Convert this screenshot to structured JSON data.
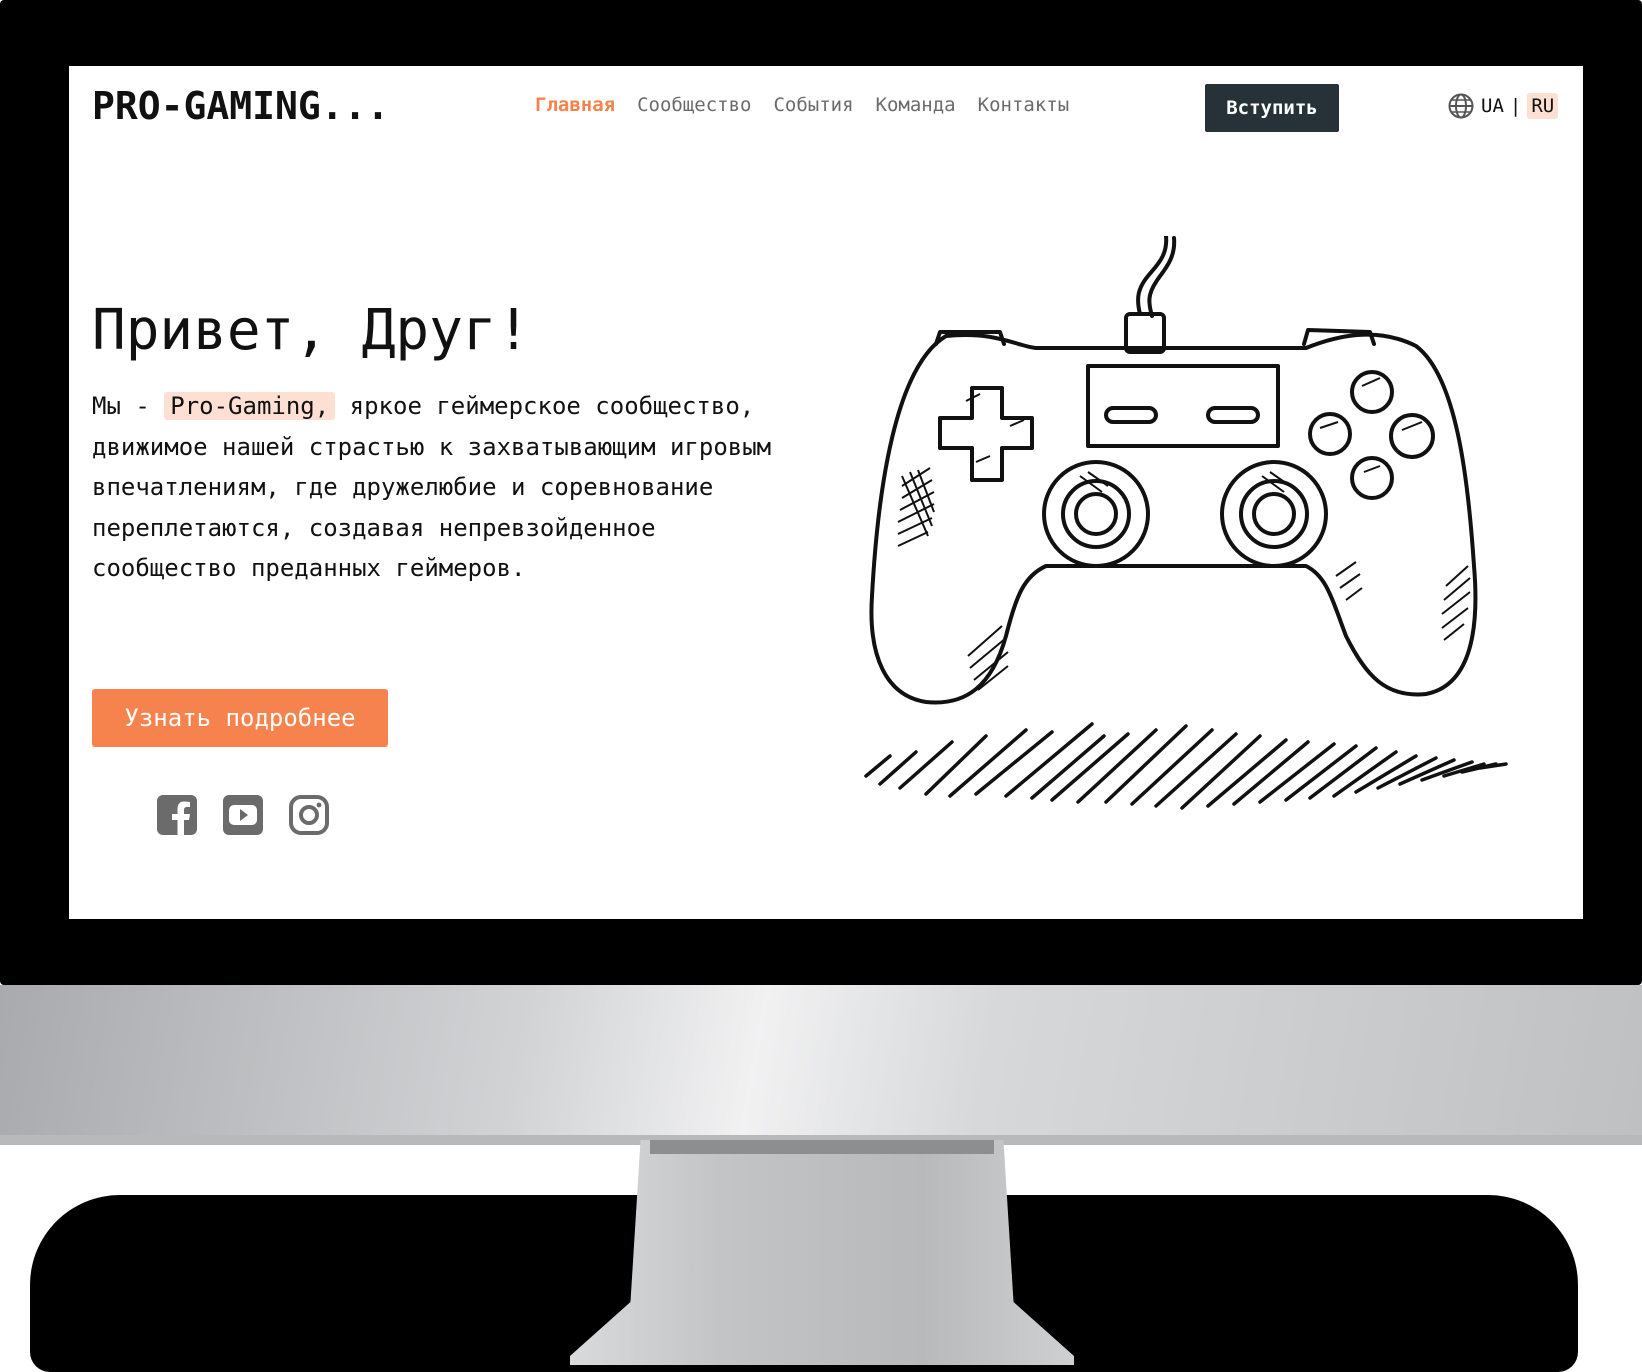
{
  "header": {
    "logo": "PRO-GAMING...",
    "nav": [
      {
        "label": "Главная",
        "active": true
      },
      {
        "label": "Сообщество",
        "active": false
      },
      {
        "label": "События",
        "active": false
      },
      {
        "label": "Команда",
        "active": false
      },
      {
        "label": "Контакты",
        "active": false
      }
    ],
    "join_label": "Вступить",
    "lang": {
      "ua": "UA",
      "separator": "|",
      "ru": "RU",
      "selected": "RU"
    }
  },
  "hero": {
    "title": "Привет, Друг!",
    "text_before": "Мы - ",
    "highlight": "Pro-Gaming,",
    "text_after": " яркое геймерское сообщество, движимое нашей страстью к захватывающим игровым впечатлениям, где дружелюбие и соревнование переплетаются, создавая непревзойденное сообщество преданных геймеров.",
    "cta_label": "Узнать подробнее"
  },
  "socials": [
    "facebook-icon",
    "youtube-icon",
    "instagram-icon"
  ],
  "illustration": "gamepad-sketch",
  "colors": {
    "accent": "#f6834d",
    "highlight": "#fde0d3",
    "dark": "#263237",
    "nav_text": "#6b6b6b"
  }
}
